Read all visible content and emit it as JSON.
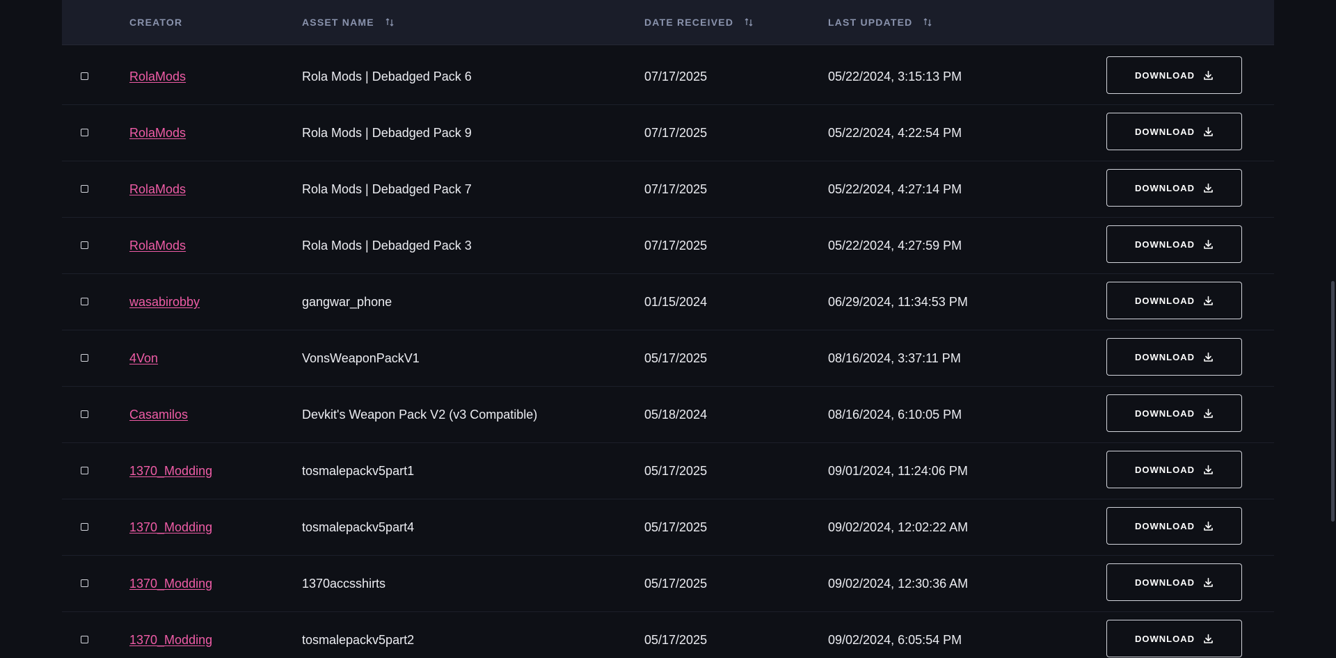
{
  "table": {
    "headers": {
      "creator": "CREATOR",
      "asset_name": "ASSET NAME",
      "date_received": "DATE RECEIVED",
      "last_updated": "LAST UPDATED"
    },
    "download_label": "DOWNLOAD",
    "rows": [
      {
        "creator": "RolaMods",
        "asset_name": "Rola Mods | Debadged Pack 6",
        "date_received": "07/17/2025",
        "last_updated": "05/22/2024, 3:15:13 PM"
      },
      {
        "creator": "RolaMods",
        "asset_name": "Rola Mods | Debadged Pack 9",
        "date_received": "07/17/2025",
        "last_updated": "05/22/2024, 4:22:54 PM"
      },
      {
        "creator": "RolaMods",
        "asset_name": "Rola Mods | Debadged Pack 7",
        "date_received": "07/17/2025",
        "last_updated": "05/22/2024, 4:27:14 PM"
      },
      {
        "creator": "RolaMods",
        "asset_name": "Rola Mods | Debadged Pack 3",
        "date_received": "07/17/2025",
        "last_updated": "05/22/2024, 4:27:59 PM"
      },
      {
        "creator": "wasabirobby",
        "asset_name": "gangwar_phone",
        "date_received": "01/15/2024",
        "last_updated": "06/29/2024, 11:34:53 PM"
      },
      {
        "creator": "4Von",
        "asset_name": "VonsWeaponPackV1",
        "date_received": "05/17/2025",
        "last_updated": "08/16/2024, 3:37:11 PM"
      },
      {
        "creator": "Casamilos",
        "asset_name": "Devkit's Weapon Pack V2 (v3 Compatible)",
        "date_received": "05/18/2024",
        "last_updated": "08/16/2024, 6:10:05 PM"
      },
      {
        "creator": "1370_Modding",
        "asset_name": "tosmalepackv5part1",
        "date_received": "05/17/2025",
        "last_updated": "09/01/2024, 11:24:06 PM"
      },
      {
        "creator": "1370_Modding",
        "asset_name": "tosmalepackv5part4",
        "date_received": "05/17/2025",
        "last_updated": "09/02/2024, 12:02:22 AM"
      },
      {
        "creator": "1370_Modding",
        "asset_name": "1370accsshirts",
        "date_received": "05/17/2025",
        "last_updated": "09/02/2024, 12:30:36 AM"
      },
      {
        "creator": "1370_Modding",
        "asset_name": "tosmalepackv5part2",
        "date_received": "05/17/2025",
        "last_updated": "09/02/2024, 6:05:54 PM"
      }
    ]
  },
  "colors": {
    "background": "#0e1016",
    "header_background": "#1a1d29",
    "header_text": "#8a93ad",
    "creator_link": "#ef5ca6",
    "row_text": "#ecedf2",
    "button_border": "#d3d5dc"
  },
  "icons": {
    "sort": "sort-arrows-icon",
    "download": "download-icon",
    "checkbox": "checkbox-icon"
  }
}
